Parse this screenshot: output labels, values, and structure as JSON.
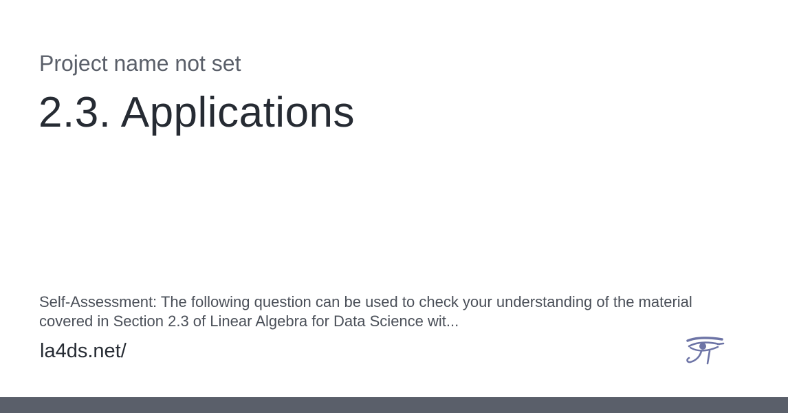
{
  "card": {
    "project_name": "Project name not set",
    "title": "2.3. Applications",
    "description": "Self-Assessment: The following question can be used to check your understanding of the material covered in Section 2.3 of Linear Algebra for Data Science wit...",
    "url": "la4ds.net/",
    "logo_icon": "eye-of-horus-icon"
  },
  "colors": {
    "logo": "#6d74a6",
    "footer_bar": "#5a5f6a",
    "title_text": "#262b33",
    "muted_text": "#5a5f69"
  }
}
